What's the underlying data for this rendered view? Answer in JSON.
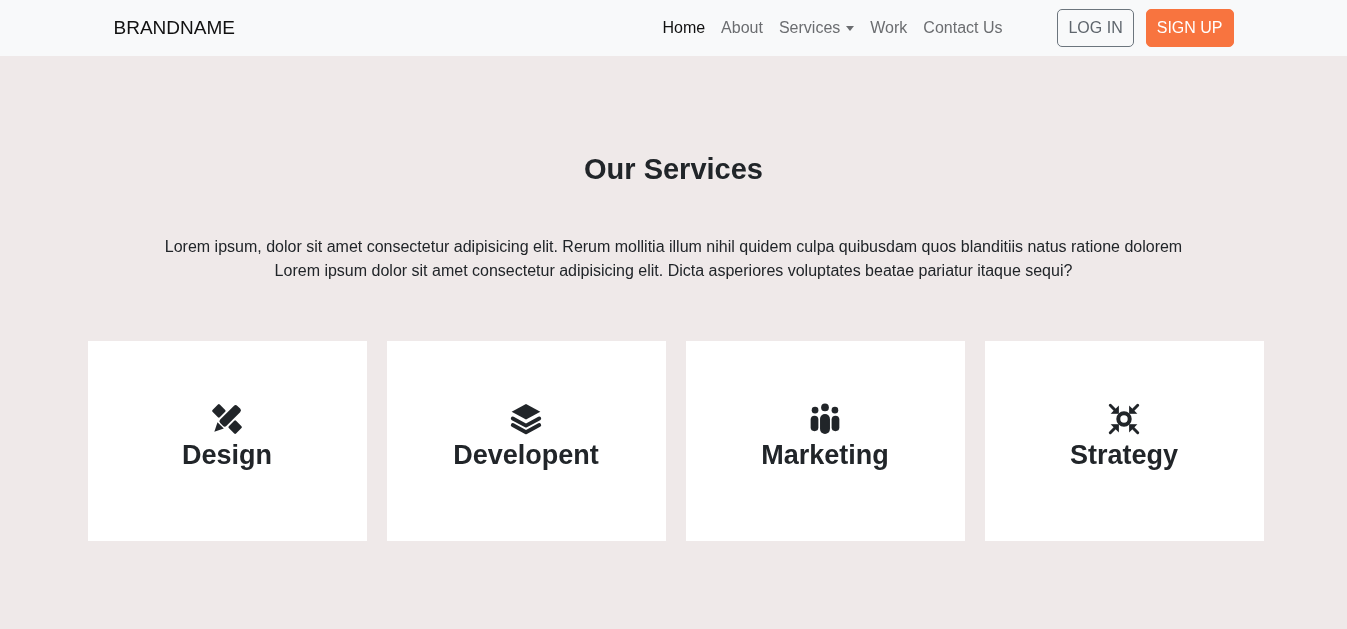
{
  "navbar": {
    "brand": "BRANDNAME",
    "links": [
      {
        "label": "Home",
        "selected": true,
        "dropdown": false
      },
      {
        "label": "About",
        "selected": false,
        "dropdown": false
      },
      {
        "label": "Services",
        "selected": false,
        "dropdown": true
      },
      {
        "label": "Work",
        "selected": false,
        "dropdown": false
      },
      {
        "label": "Contact Us",
        "selected": false,
        "dropdown": false
      }
    ],
    "buttons": [
      {
        "label": "LOG IN",
        "kind": "outline"
      },
      {
        "label": "SIGN UP",
        "kind": "filled"
      }
    ]
  },
  "section": {
    "title": "Our Services",
    "description": [
      "Lorem ipsum, dolor sit amet consectetur adipisicing elit. Rerum mollitia illum nihil quidem culpa quibusdam quos blanditiis natus ratione dolorem",
      "Lorem ipsum dolor sit amet consectetur adipisicing elit. Dicta asperiores voluptates beatae pariatur itaque sequi?"
    ]
  },
  "services": [
    {
      "title": "Design",
      "kind": "design"
    },
    {
      "title": "Developent",
      "kind": "development"
    },
    {
      "title": "Marketing",
      "kind": "marketing"
    },
    {
      "title": "Strategy",
      "kind": "strategy"
    }
  ]
}
